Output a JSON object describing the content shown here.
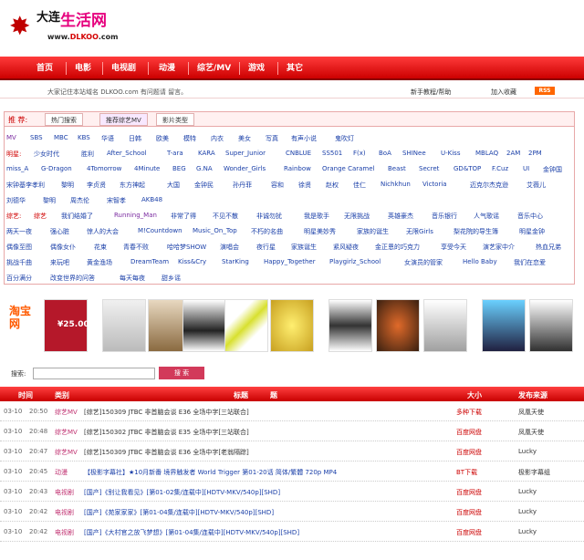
{
  "logo": {
    "big": "大连",
    "name": "生活网",
    "url_prefix": "www.",
    "url_brand": "DLKOO",
    "url_suffix": ".com"
  },
  "nav": [
    "首页",
    "电影",
    "电视剧",
    "动漫",
    "综艺/MV",
    "游戏",
    "其它"
  ],
  "infobar": {
    "msg_prefix": "大家记住本站域名 DLKOO.com",
    "msg_link1": "有问题请",
    "msg_link2": "留言",
    "msg_tail": "。",
    "help": "新手教程/帮助",
    "fav": "加入收藏",
    "rss": "RSS"
  },
  "tags": {
    "label": "推 荐:",
    "tabs": [
      "热门搜索",
      "推荐综艺MV",
      "影片类型"
    ],
    "row1": [
      "MV",
      "SBS",
      "MBC",
      "KBS",
      "华语",
      "日韩",
      "欧美",
      "模特",
      "内衣",
      "美女",
      "写真",
      "有声小说",
      "鬼吹灯"
    ],
    "row2_label": "明星:",
    "row2": [
      "少女时代",
      "胜利",
      "After_School",
      "T-ara",
      "KARA",
      "Super_Junior",
      "CNBLUE",
      "SS501",
      "F(x)",
      "BoA",
      "SHINee",
      "U-Kiss",
      "MBLAQ",
      "2AM",
      "2PM"
    ],
    "row3": [
      "miss_A",
      "G-Dragon",
      "4Tomorrow",
      "4Minute",
      "BEG",
      "G.NA",
      "Wonder_Girls",
      "Rainbow",
      "Orange Caramel",
      "Beast",
      "Secret",
      "GD&TOP",
      "F.Cuz",
      "UI",
      "金钟国"
    ],
    "row4": [
      "宋钟基李孝利",
      "黎明",
      "李贞贤",
      "东方神起",
      "大国",
      "金钟民",
      "孙丹菲",
      "容和",
      "徐贤",
      "赵权",
      "佳仁",
      "Nichkhun",
      "Victoria",
      "迈克尔杰克逊",
      "艾薇儿"
    ],
    "row5": [
      "刘德华",
      "黎明",
      "周杰伦",
      "宋智孝",
      "AKB48"
    ],
    "row6_label": "综艺:",
    "row6": [
      "综艺",
      "我们结婚了",
      "Running_Man",
      "非常了得",
      "不见不散",
      "非诚勿扰",
      "我是歌手",
      "无限挑战",
      "英雄豪杰",
      "音乐银行",
      "人气歌谣",
      "音乐中心"
    ],
    "row7": [
      "两天一夜",
      "强心脏",
      "惊人的大会",
      "M!Countdown",
      "Music_On_Top",
      "不朽的名曲",
      "明星美妙秀",
      "家族的诞生",
      "无限Girls",
      "梨花院的导生簿",
      "明星金钟"
    ],
    "row8": [
      "偶像至图",
      "偶像女仆",
      "花束",
      "青春不败",
      "哈哈梦SHOW",
      "演唱会",
      "夜行星",
      "家族诞生",
      "紧风疑夜",
      "金正恩的巧克力",
      "享受今天",
      "演艺家中介",
      "热血兄弟"
    ],
    "row9": [
      "挑战千曲",
      "来玩吧",
      "黄金渔场",
      "DreamTeam",
      "Kiss&Cry",
      "StarKing",
      "Happy_Together",
      "Playgirlz_School",
      "女演员的管家",
      "Hello Baby",
      "我们在恋爱"
    ],
    "row10": [
      "百分满分",
      "改变世界的问答",
      "每天每夜",
      "甜乡谣"
    ]
  },
  "ads": {
    "taobao": "淘宝网",
    "price": "¥25.00"
  },
  "search": {
    "label": "搜索:",
    "button": "搜 索",
    "value": ""
  },
  "table": {
    "headers": [
      "时间",
      "类别",
      "标题",
      "大小",
      "发布来源"
    ],
    "rows": [
      {
        "date": "03-10",
        "time": "20:50",
        "cat": "综艺MV",
        "title": "[综艺]150309 JTBC 非首脑会谈 E36 全场中字[三站联合]",
        "size": "多种下载",
        "src": "凤凰天使"
      },
      {
        "date": "03-10",
        "time": "20:48",
        "cat": "综艺MV",
        "title": "[综艺]150302 JTBC 非首脑会谈 E35 全场中字[三站联合]",
        "size": "百度网盘",
        "src": "凤凰天使"
      },
      {
        "date": "03-10",
        "time": "20:47",
        "cat": "综艺MV",
        "title": "[综艺]150309 JTBC 非首脑会谈 E36 全场中字[老翁隔踪]",
        "size": "百度网盘",
        "src": "Lucky"
      },
      {
        "date": "03-10",
        "time": "20:45",
        "cat": "动漫",
        "title": "【极影字幕社】★10月新番 境界触发者 World Trigger 第01-20话 简体/繁體 720p MP4",
        "size": "BT下载",
        "src": "极影字幕组"
      },
      {
        "date": "03-10",
        "time": "20:43",
        "cat": "电视剧",
        "title": "[国产]《别让我看见》[第01-02集/连载中][HDTV-MKV/540p][SHD]",
        "size": "百度网盘",
        "src": "Lucky"
      },
      {
        "date": "03-10",
        "time": "20:42",
        "cat": "电视剧",
        "title": "[国产]《苑家家家》[第01-04集/连载中][HDTV-MKV/540p][SHD]",
        "size": "百度网盘",
        "src": "Lucky"
      },
      {
        "date": "03-10",
        "time": "20:42",
        "cat": "电视剧",
        "title": "[国产]《大村官之放飞梦想》[第01-04集/连载中][HDTV-MKV/540p][SHD]",
        "size": "百度网盘",
        "src": "Lucky"
      }
    ]
  }
}
